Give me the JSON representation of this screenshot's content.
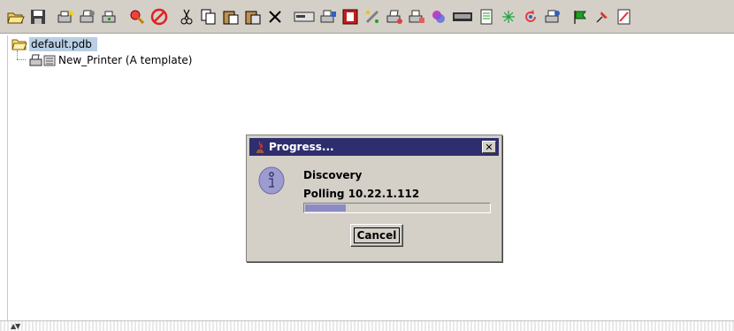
{
  "toolbar": {
    "buttons": [
      {
        "icon": "open-folder-icon"
      },
      {
        "icon": "save-icon"
      },
      {
        "icon": "new-printer-icon"
      },
      {
        "icon": "printer-properties-icon"
      },
      {
        "icon": "printer-status-icon"
      },
      {
        "icon": "discover-icon"
      },
      {
        "icon": "stop-icon"
      },
      {
        "icon": "cut-icon"
      },
      {
        "icon": "copy-icon"
      },
      {
        "icon": "paste-icon"
      },
      {
        "icon": "paste-special-icon"
      },
      {
        "icon": "delete-icon"
      },
      {
        "icon": "device-panel-icon"
      },
      {
        "icon": "print-job-icon"
      },
      {
        "icon": "alert-icon"
      },
      {
        "icon": "tools-icon"
      },
      {
        "icon": "printer-settings-icon"
      },
      {
        "icon": "printer-queue-icon"
      },
      {
        "icon": "color-icon"
      },
      {
        "icon": "keyboard-icon"
      },
      {
        "icon": "page-icon"
      },
      {
        "icon": "network-icon"
      },
      {
        "icon": "refresh-icon"
      },
      {
        "icon": "printer-group-icon"
      },
      {
        "icon": "flag-icon"
      },
      {
        "icon": "pin-icon"
      },
      {
        "icon": "report-icon"
      }
    ]
  },
  "tree": {
    "root": {
      "label": "default.pdb",
      "icon": "folder-open-icon"
    },
    "child": {
      "label": "New_Printer (A template)",
      "icon": "printer-icon"
    }
  },
  "dialog": {
    "title": "Progress...",
    "heading": "Discovery",
    "status": "Polling 10.22.1.112",
    "progress": 0.22,
    "cancel_label": "Cancel",
    "title_color": "#2e2e6e",
    "progress_color": "#8c8cc4"
  },
  "status_bar": {
    "scroll_icon": "scroll-arrows-icon"
  }
}
